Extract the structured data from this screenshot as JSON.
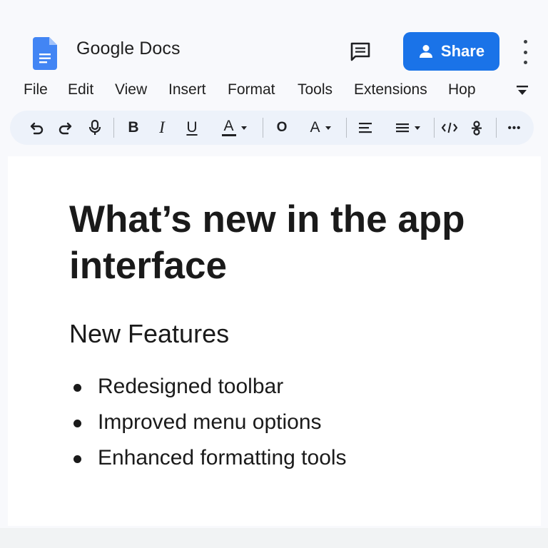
{
  "app": {
    "title": "Google Docs",
    "share_label": "Share",
    "accent_color": "#1a73e8",
    "icons": [
      "docs-logo-icon",
      "comment-icon",
      "person-icon",
      "more-vert-icon"
    ]
  },
  "menu": {
    "items": [
      "File",
      "Edit",
      "View",
      "Insert",
      "Format",
      "Tools",
      "Extensions",
      "Hop"
    ],
    "collapse_icon": "collapse-menu-icon"
  },
  "toolbar": {
    "bold": "B",
    "italic": "I",
    "underline": "U",
    "text_color": "A",
    "highlight": "O",
    "font_color": "A",
    "more": "•••",
    "icons": [
      "undo-icon",
      "redo-icon",
      "voice-icon",
      "align-left-icon",
      "list-icon",
      "code-icon",
      "strikethrough-icon"
    ]
  },
  "document": {
    "title": "What’s new in the app interface",
    "heading": "New Features",
    "bullets": [
      "Redesigned toolbar",
      "Improved menu options",
      "Enhanced formatting tools"
    ]
  }
}
